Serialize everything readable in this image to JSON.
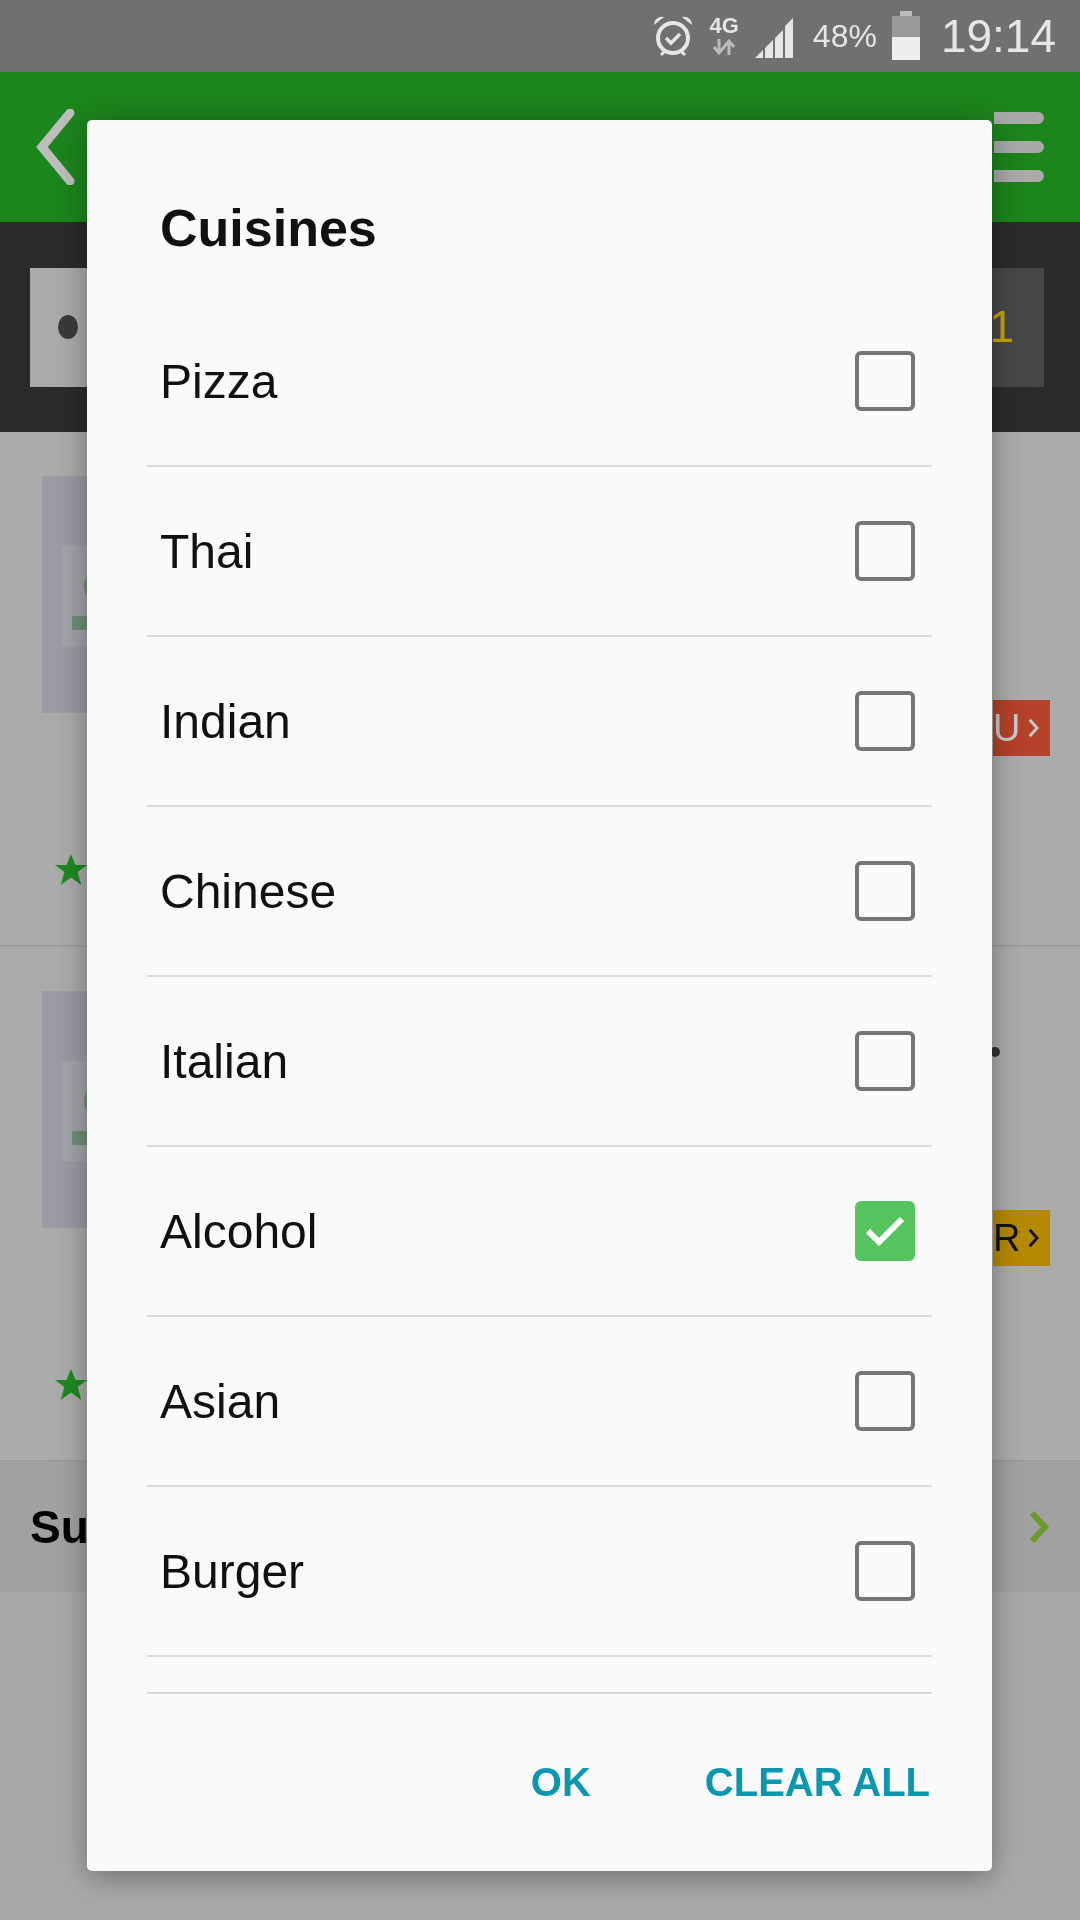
{
  "status_bar": {
    "network": "4G",
    "battery": "48%",
    "time": "19:14"
  },
  "background": {
    "search_badge": "1",
    "cards": [
      {
        "badge": "U",
        "color": "#b5412a",
        "has_dot": false
      },
      {
        "badge": "R",
        "color": "#b58a00",
        "has_dot": true
      }
    ],
    "section_title": "Su"
  },
  "dialog": {
    "title": "Cuisines",
    "options": [
      {
        "label": "Pizza",
        "checked": false
      },
      {
        "label": "Thai",
        "checked": false
      },
      {
        "label": "Indian",
        "checked": false
      },
      {
        "label": "Chinese",
        "checked": false
      },
      {
        "label": "Italian",
        "checked": false
      },
      {
        "label": "Alcohol",
        "checked": true
      },
      {
        "label": "Asian",
        "checked": false
      },
      {
        "label": "Burger",
        "checked": false
      }
    ],
    "buttons": [
      "OK",
      "CLEAR ALL"
    ]
  }
}
